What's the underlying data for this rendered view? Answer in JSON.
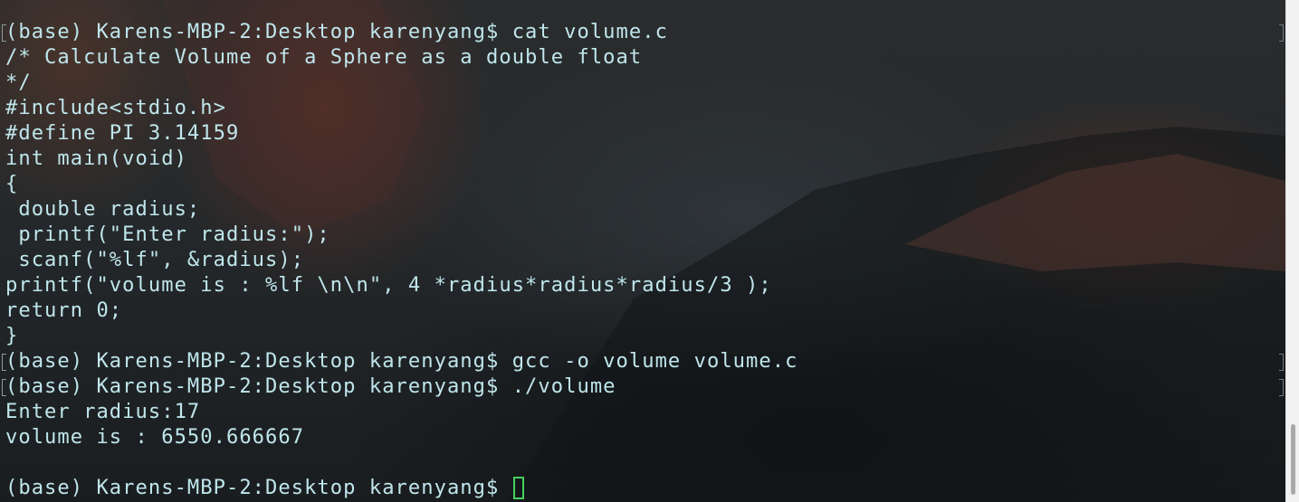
{
  "terminal": {
    "lines": [
      "(base) Karens-MBP-2:Desktop karenyang$ cat volume.c",
      "/* Calculate Volume of a Sphere as a double float",
      "*/",
      "#include<stdio.h>",
      "#define PI 3.14159",
      "int main(void)",
      "{",
      " double radius;",
      " printf(\"Enter radius:\");",
      " scanf(\"%lf\", &radius);",
      "printf(\"volume is : %lf \\n\\n\", 4 *radius*radius*radius/3 );",
      "return 0;",
      "}",
      "(base) Karens-MBP-2:Desktop karenyang$ gcc -o volume volume.c",
      "(base) Karens-MBP-2:Desktop karenyang$ ./volume",
      "Enter radius:17",
      "volume is : 6550.666667",
      "",
      "(base) Karens-MBP-2:Desktop karenyang$ "
    ],
    "prompt_marks_at_lines": [
      0,
      13,
      14
    ],
    "cursor_line": 18
  },
  "scrollbar": {
    "position_fraction": 1.0,
    "visible_fraction": 0.14
  },
  "colors": {
    "text": "#bfe6ec",
    "cursor": "#46d160",
    "background": "#1d2124",
    "scrollbar_track": "#f1f1f1",
    "scrollbar_thumb": "#a9a9a9"
  }
}
